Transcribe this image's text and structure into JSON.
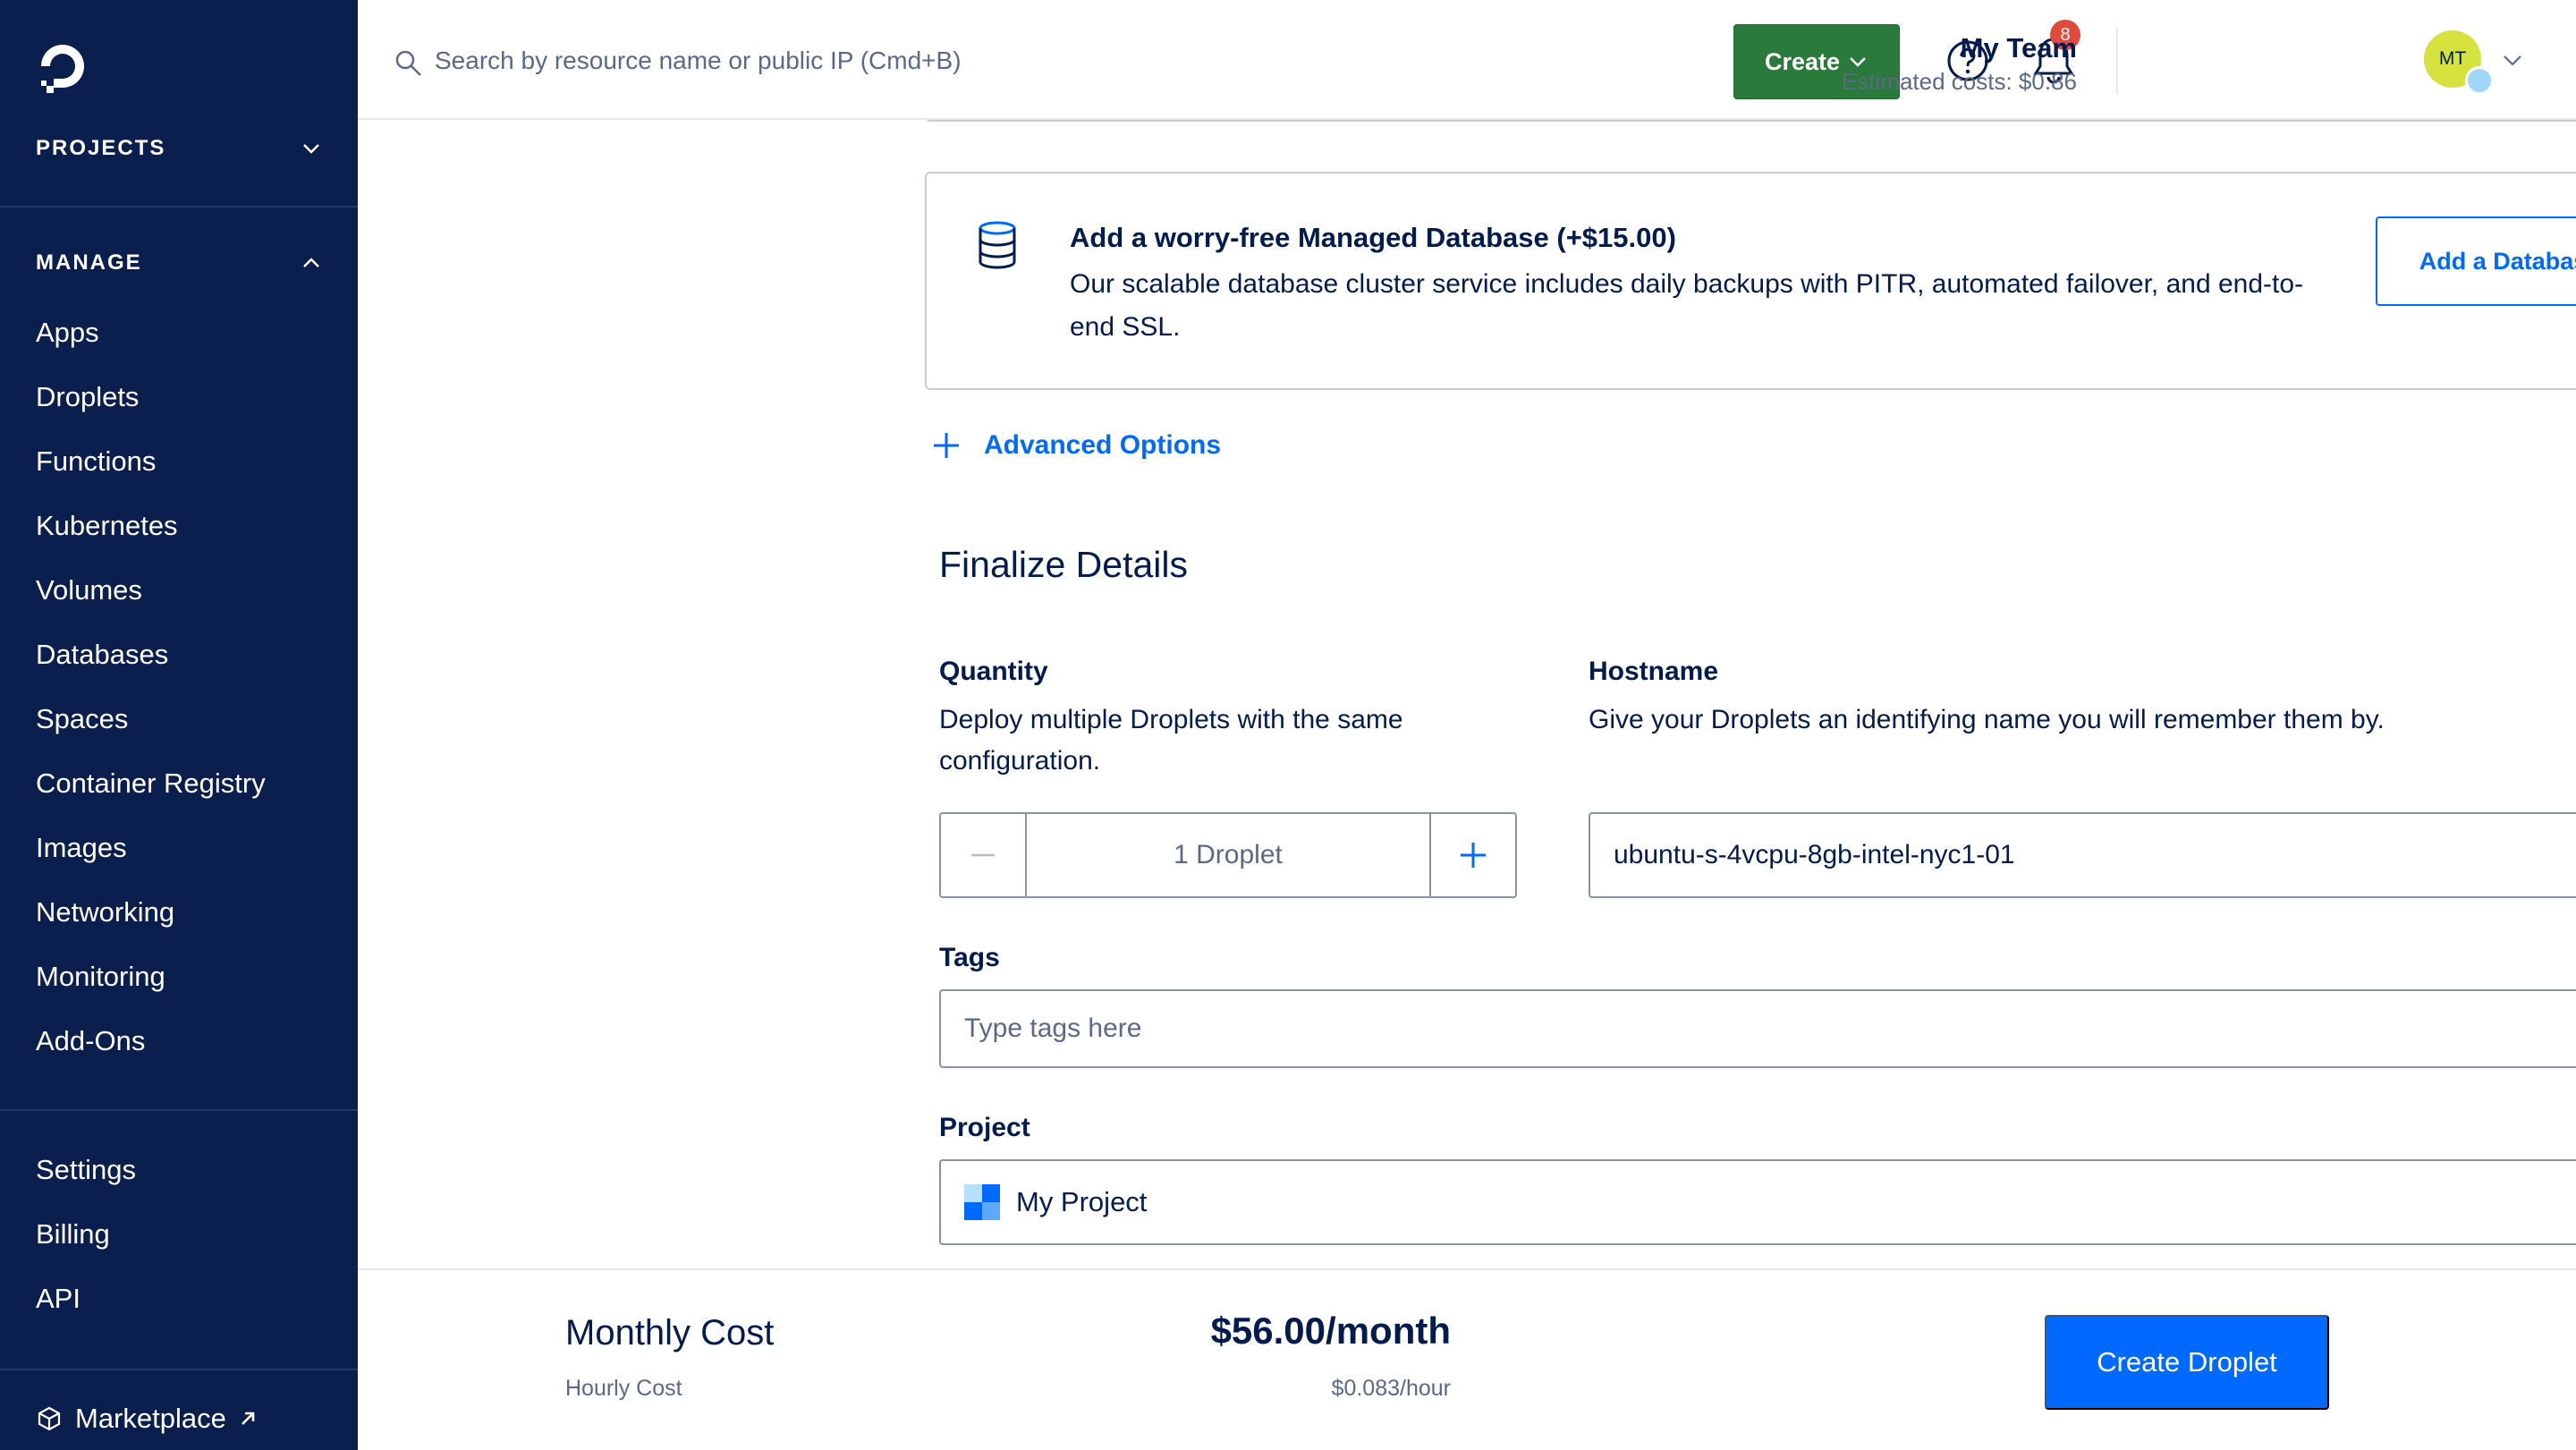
{
  "sidebar": {
    "projects_label": "PROJECTS",
    "manage_label": "MANAGE",
    "manage_items": [
      {
        "label": "Apps"
      },
      {
        "label": "Droplets"
      },
      {
        "label": "Functions"
      },
      {
        "label": "Kubernetes"
      },
      {
        "label": "Volumes"
      },
      {
        "label": "Databases"
      },
      {
        "label": "Spaces"
      },
      {
        "label": "Container Registry"
      },
      {
        "label": "Images"
      },
      {
        "label": "Networking"
      },
      {
        "label": "Monitoring"
      },
      {
        "label": "Add-Ons"
      }
    ],
    "account_items": [
      {
        "label": "Settings"
      },
      {
        "label": "Billing"
      },
      {
        "label": "API"
      }
    ],
    "marketplace_label": "Marketplace"
  },
  "header": {
    "search_placeholder": "Search by resource name or public IP (Cmd+B)",
    "create_label": "Create",
    "notification_count": "8",
    "team_name": "My Team",
    "estimated_costs": "Estimated costs: $0.86",
    "avatar_initials": "MT"
  },
  "database_card": {
    "title": "Add a worry-free Managed Database (+$15.00)",
    "description": "Our scalable database cluster service includes daily backups with PITR, automated failover, and end-to-end SSL.",
    "button_label": "Add a Database"
  },
  "advanced_options_label": "Advanced Options",
  "finalize": {
    "title": "Finalize Details",
    "quantity": {
      "label": "Quantity",
      "description": "Deploy multiple Droplets with the same configuration.",
      "value": "1  Droplet"
    },
    "hostname": {
      "label": "Hostname",
      "description": "Give your Droplets an identifying name you will remember them by.",
      "value": "ubuntu-s-4vcpu-8gb-intel-nyc1-01"
    },
    "tags": {
      "label": "Tags",
      "placeholder": "Type tags here"
    },
    "project": {
      "label": "Project",
      "selected": "My Project"
    }
  },
  "footer": {
    "monthly_label": "Monthly Cost",
    "hourly_label": "Hourly Cost",
    "monthly_price": "$56.00/month",
    "hourly_price": "$0.083/hour",
    "create_button": "Create Droplet"
  },
  "colors": {
    "sidebar_bg": "#0b1f4f",
    "primary_blue": "#0069ff",
    "create_green": "#2a7a3b",
    "badge_red": "#e0493b",
    "avatar_yellow": "#d6e23d"
  }
}
